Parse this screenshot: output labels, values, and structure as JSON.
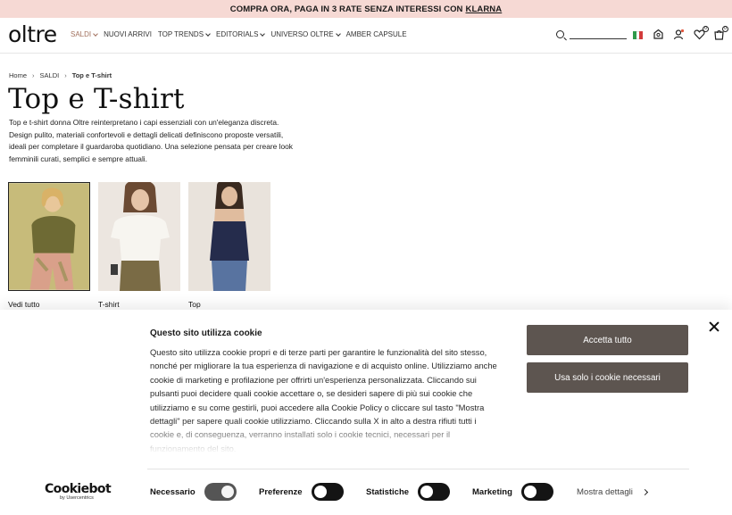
{
  "promo": {
    "text": "COMPRA ORA, PAGA IN 3 RATE SENZA INTERESSI CON",
    "link": "KLARNA"
  },
  "header": {
    "logo": "oltre",
    "nav": [
      {
        "label": "SALDI",
        "dropdown": true,
        "active": true
      },
      {
        "label": "NUOVI ARRIVI",
        "dropdown": false,
        "active": false
      },
      {
        "label": "TOP TRENDS",
        "dropdown": true,
        "active": false
      },
      {
        "label": "EDITORIALS",
        "dropdown": true,
        "active": false
      },
      {
        "label": "UNIVERSO OLTRE",
        "dropdown": true,
        "active": false
      },
      {
        "label": "AMBER CAPSULE",
        "dropdown": false,
        "active": false
      }
    ],
    "icons": [
      "search-icon",
      "italy-flag-icon",
      "store-locator-icon",
      "account-icon",
      "wishlist-icon",
      "cart-icon"
    ],
    "wishlist_count": "0",
    "cart_count": "0",
    "accent_color": "#a2715e"
  },
  "breadcrumb": {
    "items": [
      "Home",
      "SALDI",
      "Top e T-shirt"
    ]
  },
  "page": {
    "title": "Top e T-shirt",
    "description": "Top e t-shirt donna Oltre reinterpretano i capi essenziali con un'eleganza discreta. Design pulito, materiali confortevoli e dettagli delicati definiscono proposte versatili, ideali per completare il guardaroba quotidiano. Una selezione pensata per creare look femminili curati, semplici e sempre attuali."
  },
  "categories": [
    {
      "label": "Vedi tutto"
    },
    {
      "label": "T-shirt"
    },
    {
      "label": "Top"
    }
  ],
  "cookie": {
    "title": "Questo sito utilizza cookie",
    "body": "Questo sito utilizza cookie propri e di terze parti per garantire le funzionalità del sito stesso, nonché per migliorare la tua esperienza di navigazione e di acquisto online. Utilizziamo anche cookie di marketing e profilazione per offrirti un'esperienza personalizzata. Cliccando sui pulsanti puoi decidere quali cookie accettare o, se desideri sapere di più sui cookie che utilizziamo e su come gestirli, puoi accedere alla Cookie Policy o cliccare sul tasto \"Mostra dettagli\" per sapere quali cookie utilizziamo. Cliccando sulla X in alto a destra rifiuti tutti i cookie e, di conseguenza, verranno installati solo i cookie tecnici, necessari per il funzionamento del sito.",
    "accept_label": "Accetta tutto",
    "necessary_label": "Usa solo i cookie necessari",
    "brand": "Cookiebot",
    "brand_sub": "by Usercentrics",
    "toggles": [
      {
        "label": "Necessario",
        "on": true
      },
      {
        "label": "Preferenze",
        "on": false
      },
      {
        "label": "Statistiche",
        "on": false
      },
      {
        "label": "Marketing",
        "on": false
      }
    ],
    "details_label": "Mostra dettagli",
    "button_color": "#5d5550"
  }
}
